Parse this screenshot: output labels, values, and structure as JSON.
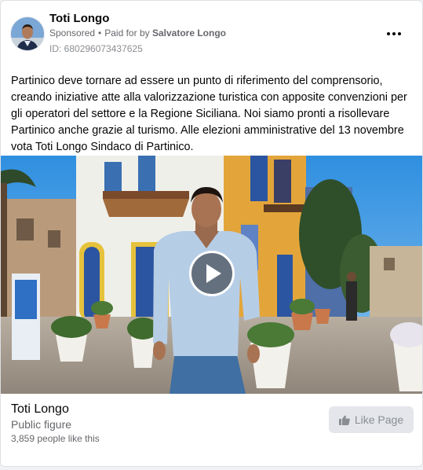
{
  "post": {
    "author": "Toti Longo",
    "sponsored_label": "Sponsored",
    "paid_for_prefix": "Paid for by",
    "paid_for_name": "Salvatore Longo",
    "ad_id": "ID: 680296073437625",
    "text": "Partinico deve tornare ad essere un punto di riferimento del comprensorio, creando iniziative atte alla valorizzazione turistica con apposite convenzioni per gli operatori del settore e la Regione Siciliana. Noi siamo pronti a risollevare Partinico anche grazie al turismo. Alle elezioni amministrative del 13 novembre vota Toti Longo Sindaco di Partinico."
  },
  "footer": {
    "page_name": "Toti Longo",
    "category": "Public figure",
    "likes": "3,859 people like this",
    "like_button_label": "Like Page"
  },
  "icons": {
    "more": "more-options-icon",
    "play": "play-icon",
    "like": "thumbs-up-icon"
  },
  "colors": {
    "text_primary": "#050505",
    "text_secondary": "#65676b",
    "button_bg": "#e4e6eb",
    "button_text": "#8a8d91"
  }
}
